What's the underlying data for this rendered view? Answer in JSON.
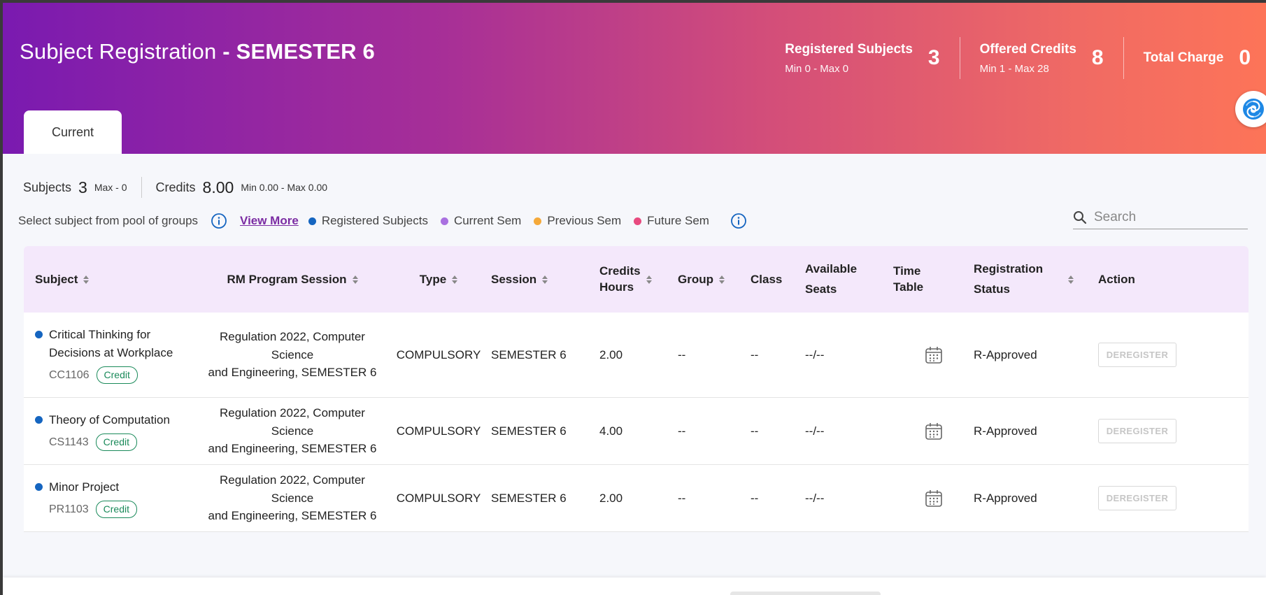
{
  "header": {
    "title": "Subject Registration",
    "separator": " - ",
    "semester": "SEMESTER 6",
    "stats": [
      {
        "label": "Registered Subjects",
        "sub": "Min 0 - Max 0",
        "value": "3"
      },
      {
        "label": "Offered Credits",
        "sub": "Min 1 - Max 28",
        "value": "8"
      },
      {
        "label": "Total Charge",
        "sub": "",
        "value": "0"
      }
    ],
    "tab_current": "Current"
  },
  "summary": {
    "subjects_label": "Subjects",
    "subjects_value": "3",
    "subjects_note": "Max - 0",
    "credits_label": "Credits",
    "credits_value": "8.00",
    "credits_note": "Min 0.00 - Max 0.00"
  },
  "legend": {
    "pool_text": "Select subject from pool of groups",
    "view_more": "View More",
    "items": [
      {
        "label": "Registered Subjects",
        "color": "#1565c0"
      },
      {
        "label": "Current Sem",
        "color": "#a970e0"
      },
      {
        "label": "Previous Sem",
        "color": "#f5a93a"
      },
      {
        "label": "Future Sem",
        "color": "#e84a7f"
      }
    ]
  },
  "search": {
    "placeholder": "Search"
  },
  "table": {
    "columns": {
      "subject": "Subject",
      "rm_program_session": "RM Program Session",
      "type": "Type",
      "session": "Session",
      "credits_1": "Credits",
      "credits_2": "Hours",
      "group": "Group",
      "class": "Class",
      "available_1": "Available",
      "available_2": "Seats",
      "timetable_1": "Time",
      "timetable_2": "Table",
      "status_1": "Registration",
      "status_2": "Status",
      "action": "Action"
    },
    "rows": [
      {
        "name_1": "Critical Thinking for",
        "name_2": "Decisions at Workplace",
        "code": "CC1106",
        "badge": "Credit",
        "rm_1": "Regulation 2022, Computer Science",
        "rm_2": "and Engineering, SEMESTER 6",
        "type": "COMPULSORY",
        "session": "SEMESTER 6",
        "credits": "2.00",
        "group": "--",
        "class": "--",
        "seats": "--/--",
        "status": "R-Approved",
        "action": "DEREGISTER"
      },
      {
        "name_1": "Theory of Computation",
        "name_2": "",
        "code": "CS1143",
        "badge": "Credit",
        "rm_1": "Regulation 2022, Computer Science",
        "rm_2": "and Engineering, SEMESTER 6",
        "type": "COMPULSORY",
        "session": "SEMESTER 6",
        "credits": "4.00",
        "group": "--",
        "class": "--",
        "seats": "--/--",
        "status": "R-Approved",
        "action": "DEREGISTER"
      },
      {
        "name_1": "Minor Project",
        "name_2": "",
        "code": "PR1103",
        "badge": "Credit",
        "rm_1": "Regulation 2022, Computer Science",
        "rm_2": "and Engineering, SEMESTER 6",
        "type": "COMPULSORY",
        "session": "SEMESTER 6",
        "credits": "2.00",
        "group": "--",
        "class": "--",
        "seats": "--/--",
        "status": "R-Approved",
        "action": "DEREGISTER"
      }
    ]
  }
}
